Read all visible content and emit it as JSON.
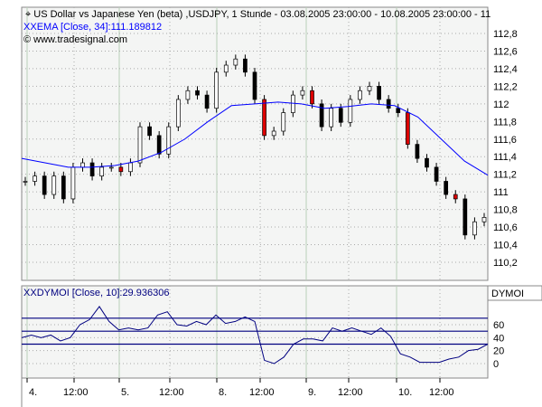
{
  "header": {
    "title": "US Dollar vs Japanese Yen (beta) ,USDJPY, 1 Stunde - 03.08.2005 23:00:00 - 10.08.2005 23:00:00 - 11",
    "ema_label": "EMA [Close, 34]:111.189812",
    "copyright": "© www.tradesignal.com"
  },
  "lower": {
    "label": "DYMOI [Close, 10]:29.936306",
    "axis_title": "DYMOI"
  },
  "colors": {
    "ema": "#0000ff",
    "dymoi": "#000080",
    "down": "#000000",
    "up": "#ffffff",
    "grid": "#b8d0b8",
    "bg": "#f4f5f4"
  },
  "chart_data": [
    {
      "type": "candlestick",
      "title": "USDJPY 1 Stunde",
      "ylim": [
        110,
        113
      ],
      "yticks": [
        "112,8",
        "112,6",
        "112,4",
        "112,2",
        "112",
        "111,8",
        "111,6",
        "111,4",
        "111,2",
        "111",
        "110,8",
        "110,6",
        "110,4",
        "110,2"
      ],
      "ytick_values": [
        112.8,
        112.6,
        112.4,
        112.2,
        112,
        111.8,
        111.6,
        111.4,
        111.2,
        111,
        110.8,
        110.6,
        110.4,
        110.2
      ],
      "closes": [
        111.12,
        111.18,
        110.97,
        111.18,
        110.92,
        111.28,
        111.33,
        111.18,
        111.28,
        111.28,
        111.23,
        111.33,
        111.74,
        111.64,
        111.43,
        111.74,
        112.05,
        112.15,
        112.1,
        111.95,
        112.36,
        112.44,
        112.51,
        112.36,
        112.05,
        111.64,
        111.69,
        111.9,
        112.1,
        112.15,
        112.0,
        111.74,
        111.95,
        111.79,
        112.05,
        112.15,
        112.2,
        112.05,
        111.95,
        111.9,
        111.54,
        111.38,
        111.28,
        111.12,
        110.97,
        110.92,
        110.51,
        110.66,
        110.71
      ],
      "ema": [
        111.38,
        111.33,
        111.28,
        111.28,
        111.3,
        111.35,
        111.45,
        111.6,
        111.8,
        111.98,
        112.0,
        112.02,
        112.0,
        111.95,
        111.97,
        112.0,
        111.98,
        111.85,
        111.6,
        111.35,
        111.19
      ]
    },
    {
      "type": "line",
      "title": "DYMOI",
      "ylim": [
        -20,
        85
      ],
      "yticks": [
        "60",
        "40",
        "20",
        "0"
      ],
      "ytick_values": [
        60,
        40,
        20,
        0
      ],
      "levels": [
        70,
        50,
        30
      ],
      "values": [
        40,
        44,
        40,
        44,
        35,
        40,
        60,
        68,
        88,
        65,
        52,
        55,
        52,
        55,
        75,
        80,
        60,
        58,
        65,
        60,
        75,
        62,
        65,
        72,
        65,
        5,
        0,
        10,
        30,
        38,
        38,
        35,
        55,
        50,
        55,
        50,
        45,
        55,
        42,
        15,
        10,
        2,
        2,
        2,
        7,
        10,
        20,
        22,
        30
      ]
    },
    {
      "type": "axis",
      "xticks": [
        "4.",
        "12:00",
        "5.",
        "12:00",
        "8.",
        "12:00",
        "9.",
        "12:00",
        "10.",
        "12:00"
      ]
    }
  ]
}
